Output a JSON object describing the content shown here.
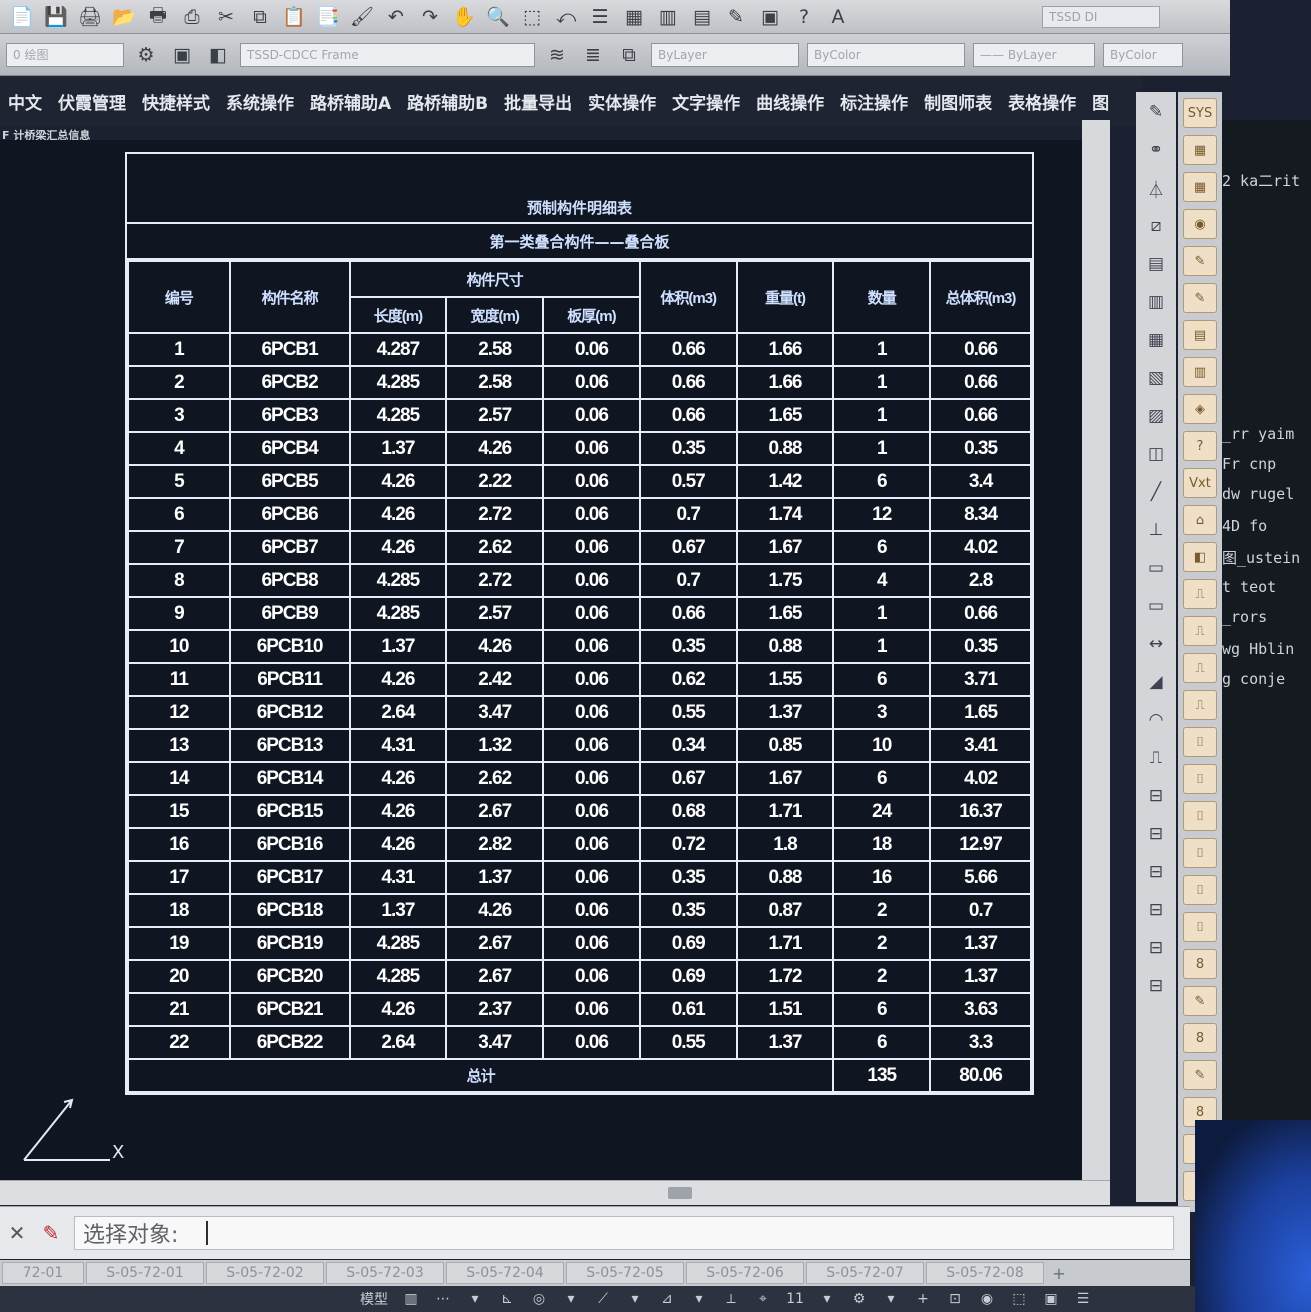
{
  "toolbar1": {
    "icons": [
      "new-icon",
      "save-icon",
      "print-icon",
      "open-icon",
      "plot-icon",
      "publish-icon",
      "cut-icon",
      "copy-icon",
      "paste-icon",
      "paste-special-icon",
      "match-properties-icon",
      "undo-icon",
      "redo-icon",
      "pan-icon",
      "zoom-icon",
      "zoom-window-icon",
      "zoom-previous-icon",
      "properties-icon",
      "design-center-icon",
      "tool-palettes-icon",
      "sheet-set-icon",
      "markup-icon",
      "calculator-icon",
      "help-icon",
      "text-style-icon"
    ],
    "glyphs": [
      "📄",
      "💾",
      "🖨",
      "📂",
      "🖶",
      "⎙",
      "✂",
      "⧉",
      "📋",
      "📑",
      "🖌",
      "↶",
      "↷",
      "✋",
      "🔍",
      "⬚",
      "⤺",
      "☰",
      "▦",
      "▥",
      "▤",
      "✎",
      "▣",
      "?",
      "A"
    ],
    "style_combo": "TSSD DI"
  },
  "toolbar2": {
    "workspace_combo": "0   绘图",
    "frame_field": "TSSD-CDCC Frame",
    "layer_combo": "ByLayer",
    "color_combo": "ByColor",
    "linetype_combo": "—— ByLayer",
    "lineweight_combo": "ByColor"
  },
  "menu": [
    "中文",
    "伏霞管理",
    "快捷样式",
    "系统操作",
    "路桥辅助A",
    "路桥辅助B",
    "批量导出",
    "实体操作",
    "文字操作",
    "曲线操作",
    "标注操作",
    "制图师表",
    "表格操作",
    "图"
  ],
  "drawing_tab": "F 计桥梁汇总信息",
  "table": {
    "title": "预制构件明细表",
    "subtitle": "第一类叠合构件——叠合板",
    "header_group": "构件尺寸",
    "headers": {
      "index": "编号",
      "name": "构件名称",
      "length": "长度(m)",
      "width": "宽度(m)",
      "thickness": "板厚(m)",
      "volume": "体积(m3)",
      "weight": "重量(t)",
      "count": "数量",
      "total_volume": "总体积(m3)"
    },
    "rows": [
      [
        "1",
        "6PCB1",
        "4.287",
        "2.58",
        "0.06",
        "0.66",
        "1.66",
        "1",
        "0.66"
      ],
      [
        "2",
        "6PCB2",
        "4.285",
        "2.58",
        "0.06",
        "0.66",
        "1.66",
        "1",
        "0.66"
      ],
      [
        "3",
        "6PCB3",
        "4.285",
        "2.57",
        "0.06",
        "0.66",
        "1.65",
        "1",
        "0.66"
      ],
      [
        "4",
        "6PCB4",
        "1.37",
        "4.26",
        "0.06",
        "0.35",
        "0.88",
        "1",
        "0.35"
      ],
      [
        "5",
        "6PCB5",
        "4.26",
        "2.22",
        "0.06",
        "0.57",
        "1.42",
        "6",
        "3.4"
      ],
      [
        "6",
        "6PCB6",
        "4.26",
        "2.72",
        "0.06",
        "0.7",
        "1.74",
        "12",
        "8.34"
      ],
      [
        "7",
        "6PCB7",
        "4.26",
        "2.62",
        "0.06",
        "0.67",
        "1.67",
        "6",
        "4.02"
      ],
      [
        "8",
        "6PCB8",
        "4.285",
        "2.72",
        "0.06",
        "0.7",
        "1.75",
        "4",
        "2.8"
      ],
      [
        "9",
        "6PCB9",
        "4.285",
        "2.57",
        "0.06",
        "0.66",
        "1.65",
        "1",
        "0.66"
      ],
      [
        "10",
        "6PCB10",
        "1.37",
        "4.26",
        "0.06",
        "0.35",
        "0.88",
        "1",
        "0.35"
      ],
      [
        "11",
        "6PCB11",
        "4.26",
        "2.42",
        "0.06",
        "0.62",
        "1.55",
        "6",
        "3.71"
      ],
      [
        "12",
        "6PCB12",
        "2.64",
        "3.47",
        "0.06",
        "0.55",
        "1.37",
        "3",
        "1.65"
      ],
      [
        "13",
        "6PCB13",
        "4.31",
        "1.32",
        "0.06",
        "0.34",
        "0.85",
        "10",
        "3.41"
      ],
      [
        "14",
        "6PCB14",
        "4.26",
        "2.62",
        "0.06",
        "0.67",
        "1.67",
        "6",
        "4.02"
      ],
      [
        "15",
        "6PCB15",
        "4.26",
        "2.67",
        "0.06",
        "0.68",
        "1.71",
        "24",
        "16.37"
      ],
      [
        "16",
        "6PCB16",
        "4.26",
        "2.82",
        "0.06",
        "0.72",
        "1.8",
        "18",
        "12.97"
      ],
      [
        "17",
        "6PCB17",
        "4.31",
        "1.37",
        "0.06",
        "0.35",
        "0.88",
        "16",
        "5.66"
      ],
      [
        "18",
        "6PCB18",
        "1.37",
        "4.26",
        "0.06",
        "0.35",
        "0.87",
        "2",
        "0.7"
      ],
      [
        "19",
        "6PCB19",
        "4.285",
        "2.67",
        "0.06",
        "0.69",
        "1.71",
        "2",
        "1.37"
      ],
      [
        "20",
        "6PCB20",
        "4.285",
        "2.67",
        "0.06",
        "0.69",
        "1.72",
        "2",
        "1.37"
      ],
      [
        "21",
        "6PCB21",
        "4.26",
        "2.37",
        "0.06",
        "0.61",
        "1.51",
        "6",
        "3.63"
      ],
      [
        "22",
        "6PCB22",
        "2.64",
        "3.47",
        "0.06",
        "0.55",
        "1.37",
        "6",
        "3.3"
      ]
    ],
    "total_label": "总计",
    "total_count": "135",
    "total_volume": "80.06"
  },
  "ucs": {
    "x_label": "X"
  },
  "palette1_glyphs": [
    "✎",
    "⚭",
    "⏃",
    "⧄",
    "▤",
    "▥",
    "▦",
    "▧",
    "▨",
    "◫",
    "╱",
    "⊥",
    "▭",
    "▭",
    "↔",
    "◢",
    "◠",
    "⎍",
    "⊟",
    "⊟",
    "⊟",
    "⊟",
    "⊟",
    "⊟"
  ],
  "palette2_glyphs": [
    "SYS",
    "▦",
    "▦",
    "◉",
    "✎",
    "✎",
    "▤",
    "▥",
    "◈",
    "?",
    "Vxt",
    "⌂",
    "◧",
    "⎍",
    "⎍",
    "⎍",
    "⎍",
    "⌷",
    "⌷",
    "⌷",
    "⌷",
    "⌷",
    "⌷",
    "8",
    "✎",
    "8",
    "✎",
    "8",
    "8",
    "⇔"
  ],
  "bg_window": {
    "lines": [
      "2 ka二rit",
      "_rr yaim",
      "Fr cnp",
      "dw rugel",
      "4D  fo",
      "图_ustein",
      "t  teot",
      "_rors",
      "wg  Hblin",
      "g  conje"
    ]
  },
  "command": {
    "prompt": "选择对象:"
  },
  "layout_tabs": [
    "72-01",
    "S-05-72-01",
    "S-05-72-02",
    "S-05-72-03",
    "S-05-72-04",
    "S-05-72-05",
    "S-05-72-06",
    "S-05-72-07",
    "S-05-72-08"
  ],
  "status": [
    "模型",
    "▥",
    "⋯",
    "▾",
    "⊾",
    "◎",
    "▾",
    "⟋",
    "▾",
    "⊿",
    "▾",
    "⟂",
    "⌖",
    "11",
    "▾",
    "⚙",
    "▾",
    "+",
    "⊡",
    "◉",
    "⬚",
    "▣",
    "☰"
  ]
}
